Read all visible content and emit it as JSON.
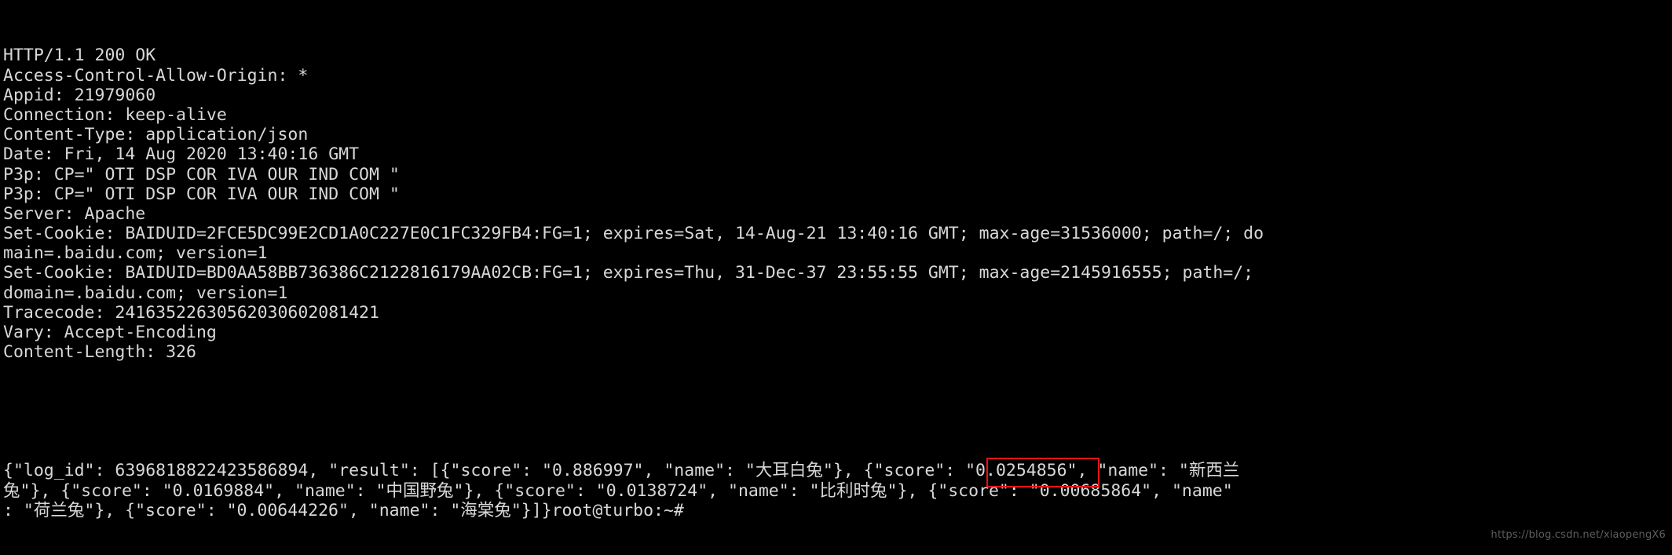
{
  "terminal": {
    "prompt": "root@turbo:~#",
    "response_lines": [
      "HTTP/1.1 200 OK",
      "Access-Control-Allow-Origin: *",
      "Appid: 21979060",
      "Connection: keep-alive",
      "Content-Type: application/json",
      "Date: Fri, 14 Aug 2020 13:40:16 GMT",
      "P3p: CP=\" OTI DSP COR IVA OUR IND COM \"",
      "P3p: CP=\" OTI DSP COR IVA OUR IND COM \"",
      "Server: Apache",
      "Set-Cookie: BAIDUID=2FCE5DC99E2CD1A0C227E0C1FC329FB4:FG=1; expires=Sat, 14-Aug-21 13:40:16 GMT; max-age=31536000; path=/; do",
      "main=.baidu.com; version=1",
      "Set-Cookie: BAIDUID=BD0AA58BB736386C2122816179AA02CB:FG=1; expires=Thu, 31-Dec-37 23:55:55 GMT; max-age=2145916555; path=/;",
      "domain=.baidu.com; version=1",
      "Tracecode: 24163522630562030602081421",
      "Vary: Accept-Encoding",
      "Content-Length: 326"
    ],
    "body_lines": [
      "{\"log_id\": 6396818822423586894, \"result\": [{\"score\": \"0.886997\", \"name\": \"大耳白兔\"}, {\"score\": \"0.0254856\", \"name\": \"新西兰",
      "兔\"}, {\"score\": \"0.0169884\", \"name\": \"中国野兔\"}, {\"score\": \"0.0138724\", \"name\": \"比利时兔\"}, {\"score\": \"0.00685864\", \"name\"",
      ": \"荷兰兔\"}, {\"score\": \"0.00644226\", \"name\": \"海棠兔\"}]}root@turbo:~#"
    ],
    "headers": {
      "status_line": "HTTP/1.1 200 OK",
      "access_control_allow_origin": "*",
      "appid": "21979060",
      "connection": "keep-alive",
      "content_type": "application/json",
      "date": "Fri, 14 Aug 2020 13:40:16 GMT",
      "p3p": "CP=\" OTI DSP COR IVA OUR IND COM \"",
      "server": "Apache",
      "set_cookie_1": "BAIDUID=2FCE5DC99E2CD1A0C227E0C1FC329FB4:FG=1; expires=Sat, 14-Aug-21 13:40:16 GMT; max-age=31536000; path=/; domain=.baidu.com; version=1",
      "set_cookie_2": "BAIDUID=BD0AA58BB736386C2122816179AA02CB:FG=1; expires=Thu, 31-Dec-37 23:55:55 GMT; max-age=2145916555; path=/; domain=.baidu.com; version=1",
      "tracecode": "24163522630562030602081421",
      "vary": "Accept-Encoding",
      "content_length": "326"
    },
    "json_body": {
      "log_id": "6396818822423586894",
      "results": [
        {
          "score": "0.886997",
          "name": "大耳白兔",
          "highlighted": true
        },
        {
          "score": "0.0254856",
          "name": "新西兰兔",
          "highlighted": false
        },
        {
          "score": "0.0169884",
          "name": "中国野兔",
          "highlighted": false
        },
        {
          "score": "0.0138724",
          "name": "比利时兔",
          "highlighted": false
        },
        {
          "score": "0.00685864",
          "name": "荷兰兔",
          "highlighted": false
        },
        {
          "score": "0.00644226",
          "name": "海棠兔",
          "highlighted": false
        }
      ]
    }
  },
  "annotation": {
    "highlight_color": "#e81313",
    "highlight_target": "大耳白兔"
  },
  "watermark": {
    "text": "https://blog.csdn.net/xiaopengX6"
  },
  "colors": {
    "background": "#000000",
    "foreground": "#d8d8d8",
    "accent": "#e81313",
    "watermark": "#5e5e5e"
  }
}
